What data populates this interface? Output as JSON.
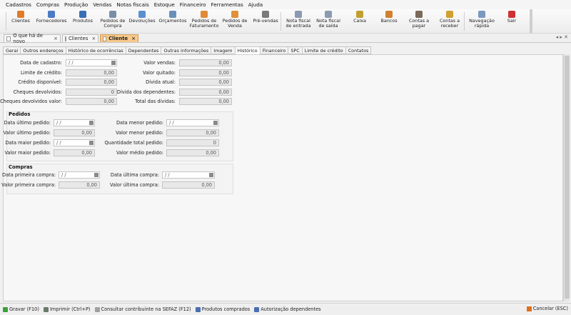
{
  "menu": [
    "Cadastros",
    "Compras",
    "Produção",
    "Vendas",
    "Notas fiscais",
    "Estoque",
    "Financeiro",
    "Ferramentas",
    "Ajuda"
  ],
  "toolbar": [
    {
      "label": "Clientes",
      "icon": "clients-icon",
      "color": "#e07b2a"
    },
    {
      "label": "Fornecedores",
      "icon": "suppliers-icon",
      "color": "#4a7bc4"
    },
    {
      "label": "Produtos",
      "icon": "products-icon",
      "color": "#3a6fb5"
    },
    {
      "label": "Pedidos de\nCompra",
      "icon": "purchase-orders-icon",
      "color": "#7a8ea8"
    },
    {
      "label": "Devoluções",
      "icon": "returns-icon",
      "color": "#5a8fd0"
    },
    {
      "label": "Orçamentos",
      "icon": "quotes-icon",
      "color": "#6b8fb8"
    },
    {
      "label": "Pedidos de\nFaturamento",
      "icon": "billing-orders-icon",
      "color": "#e08a3a"
    },
    {
      "label": "Pedidos de\nVenda",
      "icon": "sales-orders-icon",
      "color": "#e0903a"
    },
    {
      "label": "Pré-vendas",
      "icon": "pre-sales-icon",
      "color": "#7a7a7a"
    },
    {
      "label": "Nota fiscal\nde entrada",
      "icon": "entry-invoice-icon",
      "color": "#8a9ab0"
    },
    {
      "label": "Nota fiscal\nde saída",
      "icon": "exit-invoice-icon",
      "color": "#8a9ab0"
    },
    {
      "label": "Caixa",
      "icon": "cash-icon",
      "color": "#c0a030"
    },
    {
      "label": "Bancos",
      "icon": "banks-icon",
      "color": "#d08030"
    },
    {
      "label": "Contas a\npagar",
      "icon": "payables-icon",
      "color": "#7a6a5a"
    },
    {
      "label": "Contas a\nreceber",
      "icon": "receivables-icon",
      "color": "#d0a030"
    },
    {
      "label": "Navegação\nrápida",
      "icon": "quick-nav-icon",
      "color": "#7a9ac0"
    },
    {
      "label": "Sair",
      "icon": "exit-icon",
      "color": "#d03030"
    }
  ],
  "doc_tabs": [
    {
      "label": "O que há de novo",
      "active": false
    },
    {
      "label": "Clientes",
      "active": false
    },
    {
      "label": "Cliente",
      "active": true
    }
  ],
  "nav_arrows": "◂ ▸ ✕",
  "subtabs": [
    "Geral",
    "Outros endereços",
    "Histórico de ocorrências",
    "Dependentes",
    "Outras informações",
    "Imagem",
    "Histórico",
    "Financeiro",
    "SPC",
    "Limite de crédito",
    "Contatos"
  ],
  "active_subtab": "Histórico",
  "summary": {
    "left": [
      {
        "label": "Data de cadastro:",
        "value": " / /",
        "date": true
      },
      {
        "label": "Limite de crédito:",
        "value": "0,00"
      },
      {
        "label": "Crédito disponível:",
        "value": "0,00"
      },
      {
        "label": "Cheques devolvidos:",
        "value": "0"
      },
      {
        "label": "Cheques devolvidos valor:",
        "value": "0,00"
      }
    ],
    "right": [
      {
        "label": "Valor vendas:",
        "value": "0,00"
      },
      {
        "label": "Valor quitado:",
        "value": "0,00"
      },
      {
        "label": "Dívida atual:",
        "value": "0,00"
      },
      {
        "label": "Dívida dos dependentes:",
        "value": "0,00"
      },
      {
        "label": "Total das dívidas:",
        "value": "0,00"
      }
    ]
  },
  "pedidos": {
    "title": "Pedidos",
    "left": [
      {
        "label": "Data último pedido:",
        "value": " / /",
        "date": true
      },
      {
        "label": "Valor último pedido:",
        "value": "0,00"
      },
      {
        "label": "Data maior pedido:",
        "value": " / /",
        "date": true
      },
      {
        "label": "Valor maior pedido:",
        "value": "0,00"
      }
    ],
    "right": [
      {
        "label": "Data menor pedido:",
        "value": " / /",
        "date": true
      },
      {
        "label": "Valor menor pedido:",
        "value": "0,00"
      },
      {
        "label": "Quantidade total pedido:",
        "value": "0"
      },
      {
        "label": "Valor médio pedido:",
        "value": "0,00"
      }
    ]
  },
  "compras": {
    "title": "Compras",
    "left": [
      {
        "label": "Data primeira compra:",
        "value": " / /",
        "date": true
      },
      {
        "label": "Valor primeira compra:",
        "value": "0,00"
      }
    ],
    "right": [
      {
        "label": "Data última compra:",
        "value": " / /",
        "date": true
      },
      {
        "label": "Valor última compra:",
        "value": "0,00"
      }
    ]
  },
  "status": [
    {
      "label": "Gravar (F10)",
      "icon": "save-check-icon",
      "color": "#3aa03a"
    },
    {
      "label": "Imprimir (Ctrl+P)",
      "icon": "print-icon",
      "color": "#6a7a6a"
    },
    {
      "label": "Consultar contribuinte na SEFAZ (F12)",
      "icon": "lightbulb-icon",
      "color": "#a0a0a0"
    },
    {
      "label": "Produtos comprados",
      "icon": "products-bought-icon",
      "color": "#4a6fb0"
    },
    {
      "label": "Autorização dependentes",
      "icon": "dependents-auth-icon",
      "color": "#4a6fb0"
    }
  ],
  "cancel": {
    "label": "Cancelar (ESC)",
    "icon": "cancel-icon",
    "color": "#e07020"
  }
}
